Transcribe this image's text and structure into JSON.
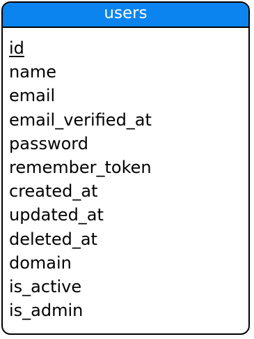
{
  "entity": {
    "title": "users",
    "header_color": "#0b84f0",
    "fields": [
      {
        "name": "id",
        "primary_key": true
      },
      {
        "name": "name",
        "primary_key": false
      },
      {
        "name": "email",
        "primary_key": false
      },
      {
        "name": "email_verified_at",
        "primary_key": false
      },
      {
        "name": "password",
        "primary_key": false
      },
      {
        "name": "remember_token",
        "primary_key": false
      },
      {
        "name": "created_at",
        "primary_key": false
      },
      {
        "name": "updated_at",
        "primary_key": false
      },
      {
        "name": "deleted_at",
        "primary_key": false
      },
      {
        "name": "domain",
        "primary_key": false
      },
      {
        "name": "is_active",
        "primary_key": false
      },
      {
        "name": "is_admin",
        "primary_key": false
      }
    ]
  }
}
